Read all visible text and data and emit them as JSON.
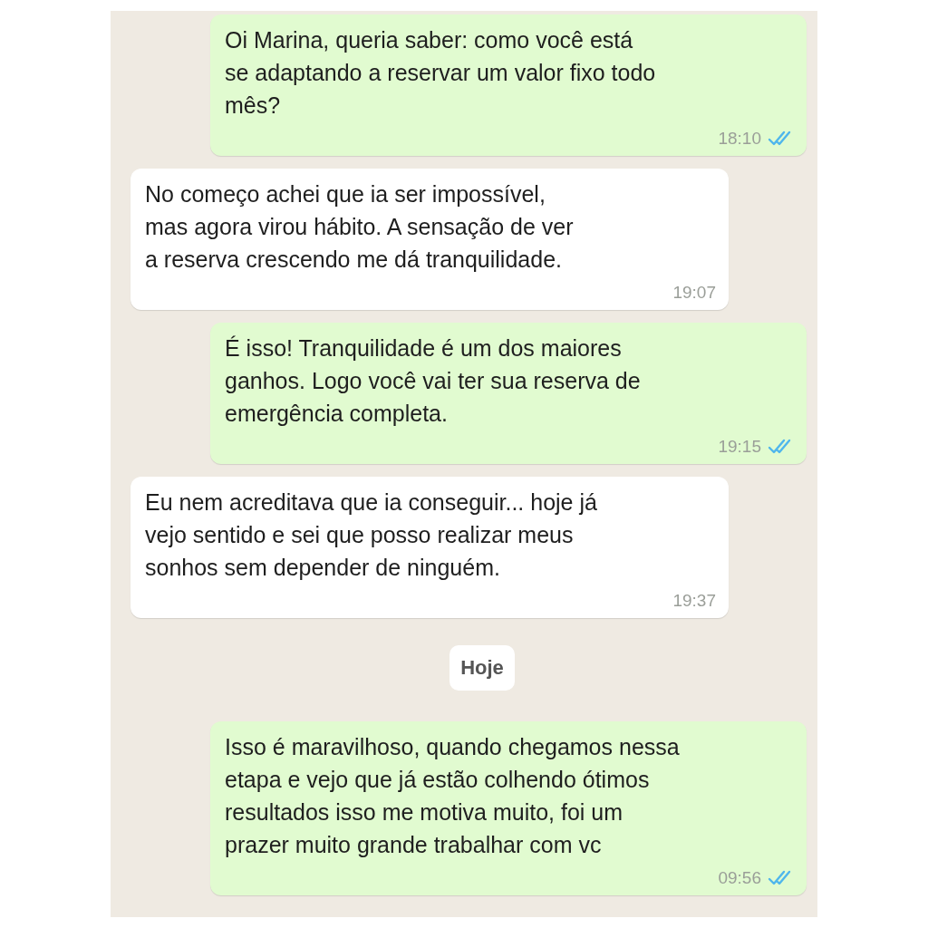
{
  "messages": [
    {
      "kind": "out",
      "text": "Oi Marina, queria saber: como você está\nse adaptando a reservar um valor fixo todo\nmês?",
      "time": "18:10",
      "read": true
    },
    {
      "kind": "in",
      "text": "No começo achei que ia ser impossível,\nmas agora virou hábito. A sensação de ver\na reserva crescendo me dá tranquilidade.",
      "time": "19:07"
    },
    {
      "kind": "out",
      "text": "É isso! Tranquilidade é um dos maiores\nganhos. Logo você vai ter sua reserva de\nemergência completa.",
      "time": "19:15",
      "read": true
    },
    {
      "kind": "in",
      "text": "Eu nem acreditava que ia conseguir... hoje já\nvejo sentido e sei que posso realizar meus\nsonhos sem depender de ninguém.",
      "time": "19:37"
    },
    {
      "kind": "date",
      "text": "Hoje"
    },
    {
      "kind": "out",
      "text": "Isso é maravilhoso, quando chegamos nessa\netapa e vejo que já estão colhendo ótimos\nresultados isso me motiva muito, foi um\nprazer muito grande trabalhar com vc",
      "time": "09:56",
      "read": true
    }
  ]
}
